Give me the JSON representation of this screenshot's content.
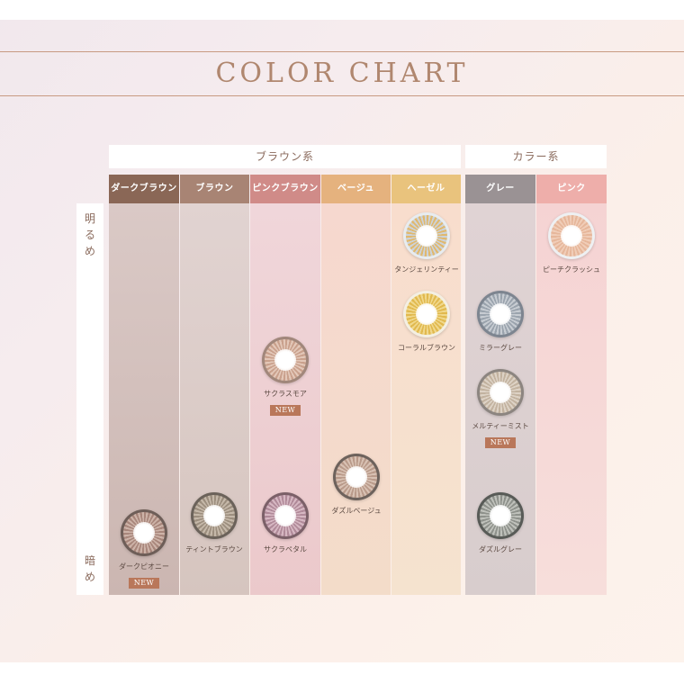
{
  "title": "COLOR CHART",
  "groups": {
    "brown": "ブラウン系",
    "color": "カラー系"
  },
  "axis": {
    "top": "明るめ",
    "bottom": "暗め"
  },
  "columns": [
    {
      "label": "ダークブラウン",
      "head_color": "#8a6756"
    },
    {
      "label": "ブラウン",
      "head_color": "#a88474"
    },
    {
      "label": "ピンクブラウン",
      "head_color": "#d08b88"
    },
    {
      "label": "ベージュ",
      "head_color": "#e5b27e"
    },
    {
      "label": "ヘーゼル",
      "head_color": "#e9c37d"
    },
    {
      "label": "グレー",
      "head_color": "#9a9294"
    },
    {
      "label": "ピンク",
      "head_color": "#eeaeaa"
    }
  ],
  "lenses": [
    {
      "name": "タンジェリンティー"
    },
    {
      "name": "ピーチクラッシュ"
    },
    {
      "name": "コーラルブラウン"
    },
    {
      "name": "ミラーグレー"
    },
    {
      "name": "サクラスモア",
      "badge": "NEW"
    },
    {
      "name": "メルティーミスト",
      "badge": "NEW"
    },
    {
      "name": "ダズルベージュ"
    },
    {
      "name": "ダークピオニー",
      "badge": "NEW"
    },
    {
      "name": "ティントブラウン"
    },
    {
      "name": "サクラペタル"
    },
    {
      "name": "ダズルグレー"
    }
  ]
}
